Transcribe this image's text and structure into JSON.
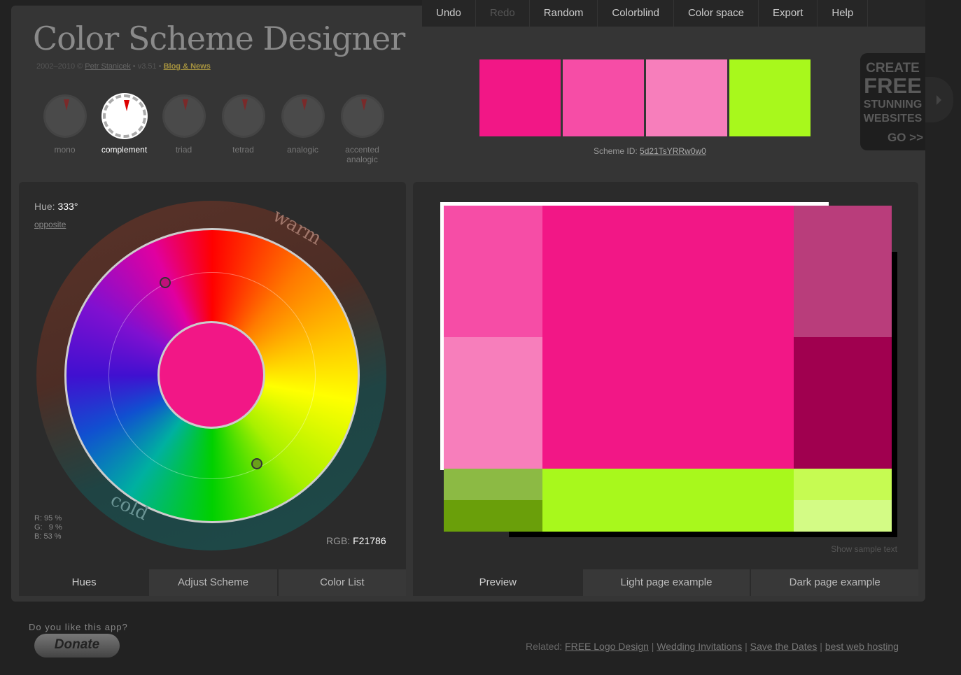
{
  "menu": [
    "Undo",
    "Redo",
    "Random",
    "Colorblind",
    "Color space",
    "Export",
    "Help"
  ],
  "header": {
    "title": "Color Scheme Designer",
    "copyright": "2002–2010 ©",
    "author": "Petr Stanicek",
    "version": "• v3.51 •",
    "blog": "Blog & News"
  },
  "modes": [
    {
      "label": "mono"
    },
    {
      "label": "complement"
    },
    {
      "label": "triad"
    },
    {
      "label": "tetrad"
    },
    {
      "label": "analogic"
    },
    {
      "label": "accented analogic"
    }
  ],
  "active_mode": "complement",
  "swatches": [
    "#F21786",
    "#F64DA6",
    "#F77EBB",
    "#A8F81C"
  ],
  "scheme": {
    "label": "Scheme ID:",
    "id": "5d21TsYRRw0w0"
  },
  "ad": {
    "l1": "CREATE",
    "l2": "FREE",
    "l3": "STUNNING",
    "l4": "WEBSITES",
    "l5": "GO >>"
  },
  "hues": {
    "hue_label": "Hue:",
    "hue_value": "333°",
    "opposite": "opposite",
    "warm": "warm",
    "cold": "cold",
    "rgb_pct": "R: 95 %\nG:   9 %\nB: 53 %",
    "rgb_label": "RGB:",
    "rgb_value": "F21786"
  },
  "left_tabs": [
    "Hues",
    "Adjust Scheme",
    "Color List"
  ],
  "right_tabs": [
    "Preview",
    "Light page example",
    "Dark page example"
  ],
  "preview": {
    "show_sample": "Show sample text",
    "colors": {
      "main": "#F21786",
      "light1": "#F64DA6",
      "light2": "#F77EBB",
      "dark1": "#B93D7B",
      "dark2": "#A0004F",
      "green": "#A8F81C",
      "green_d1": "#8CBA44",
      "green_d2": "#6A9F0A",
      "green_l1": "#C6FB52",
      "green_l2": "#D3FB85"
    }
  },
  "footer": {
    "question": "Do you like this app?",
    "donate": "Donate",
    "related_label": "Related:",
    "links": [
      "FREE Logo Design",
      "Wedding Invitations",
      "Save the Dates",
      "best web hosting"
    ]
  }
}
